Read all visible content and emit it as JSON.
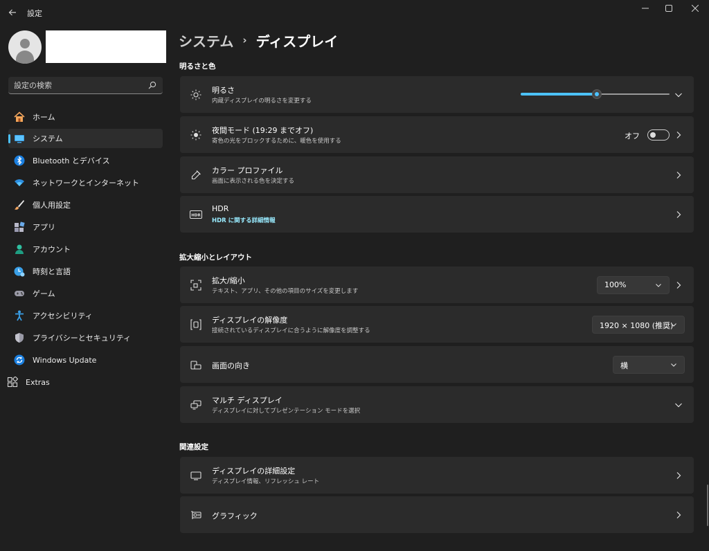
{
  "window": {
    "app_title": "設定",
    "controls": [
      "minimize-icon",
      "maximize-icon",
      "close-icon"
    ]
  },
  "colors": {
    "background": "#1f1f1f",
    "card": "#2b2b2b",
    "accent": "#4cc2ff",
    "link": "#99ebff"
  },
  "sidebar": {
    "search_placeholder": "設定の検索",
    "items": [
      {
        "label": "ホーム",
        "icon": "home-icon"
      },
      {
        "label": "システム",
        "icon": "system-icon",
        "selected": true
      },
      {
        "label": "Bluetooth とデバイス",
        "icon": "bluetooth-icon"
      },
      {
        "label": "ネットワークとインターネット",
        "icon": "network-icon"
      },
      {
        "label": "個人用設定",
        "icon": "personalization-icon"
      },
      {
        "label": "アプリ",
        "icon": "apps-icon"
      },
      {
        "label": "アカウント",
        "icon": "account-icon"
      },
      {
        "label": "時刻と言語",
        "icon": "time-language-icon"
      },
      {
        "label": "ゲーム",
        "icon": "gaming-icon"
      },
      {
        "label": "アクセシビリティ",
        "icon": "accessibility-icon"
      },
      {
        "label": "プライバシーとセキュリティ",
        "icon": "privacy-shield-icon"
      },
      {
        "label": "Windows Update",
        "icon": "windows-update-icon"
      },
      {
        "label": "Extras",
        "icon": "extras-icon"
      }
    ]
  },
  "breadcrumb": {
    "parent": "システム",
    "current": "ディスプレイ"
  },
  "sections": {
    "brightness_color": "明るさと色",
    "scale_layout": "拡大縮小とレイアウト",
    "related": "関連設定"
  },
  "brightness": {
    "title": "明るさ",
    "desc": "内蔵ディスプレイの明るさを変更する",
    "value": 0.51
  },
  "night_light": {
    "title": "夜間モード (19:29 までオフ)",
    "desc": "寄色の光をブロックするために、暖色を使用する",
    "state_label": "オフ"
  },
  "color_profile": {
    "title": "カラー プロファイル",
    "desc": "画面に表示される色を決定する"
  },
  "hdr": {
    "title": "HDR",
    "link": "HDR に関する詳細情報"
  },
  "scale": {
    "title": "拡大/縮小",
    "desc": "テキスト、アプリ、その他の項目のサイズを変更します",
    "value": "100%"
  },
  "resolution": {
    "title": "ディスプレイの解像度",
    "desc": "接続されているディスプレイに合うように解像度を調整する",
    "value": "1920 × 1080 (推奨)"
  },
  "orientation": {
    "title": "画面の向き",
    "value": "横"
  },
  "multi_display": {
    "title": "マルチ ディスプレイ",
    "desc": "ディスプレイに対してプレゼンテーション モードを選択"
  },
  "advanced_display": {
    "title": "ディスプレイの詳細設定",
    "desc": "ディスプレイ情報、リフレッシュ レート"
  },
  "graphics": {
    "title": "グラフィック"
  }
}
